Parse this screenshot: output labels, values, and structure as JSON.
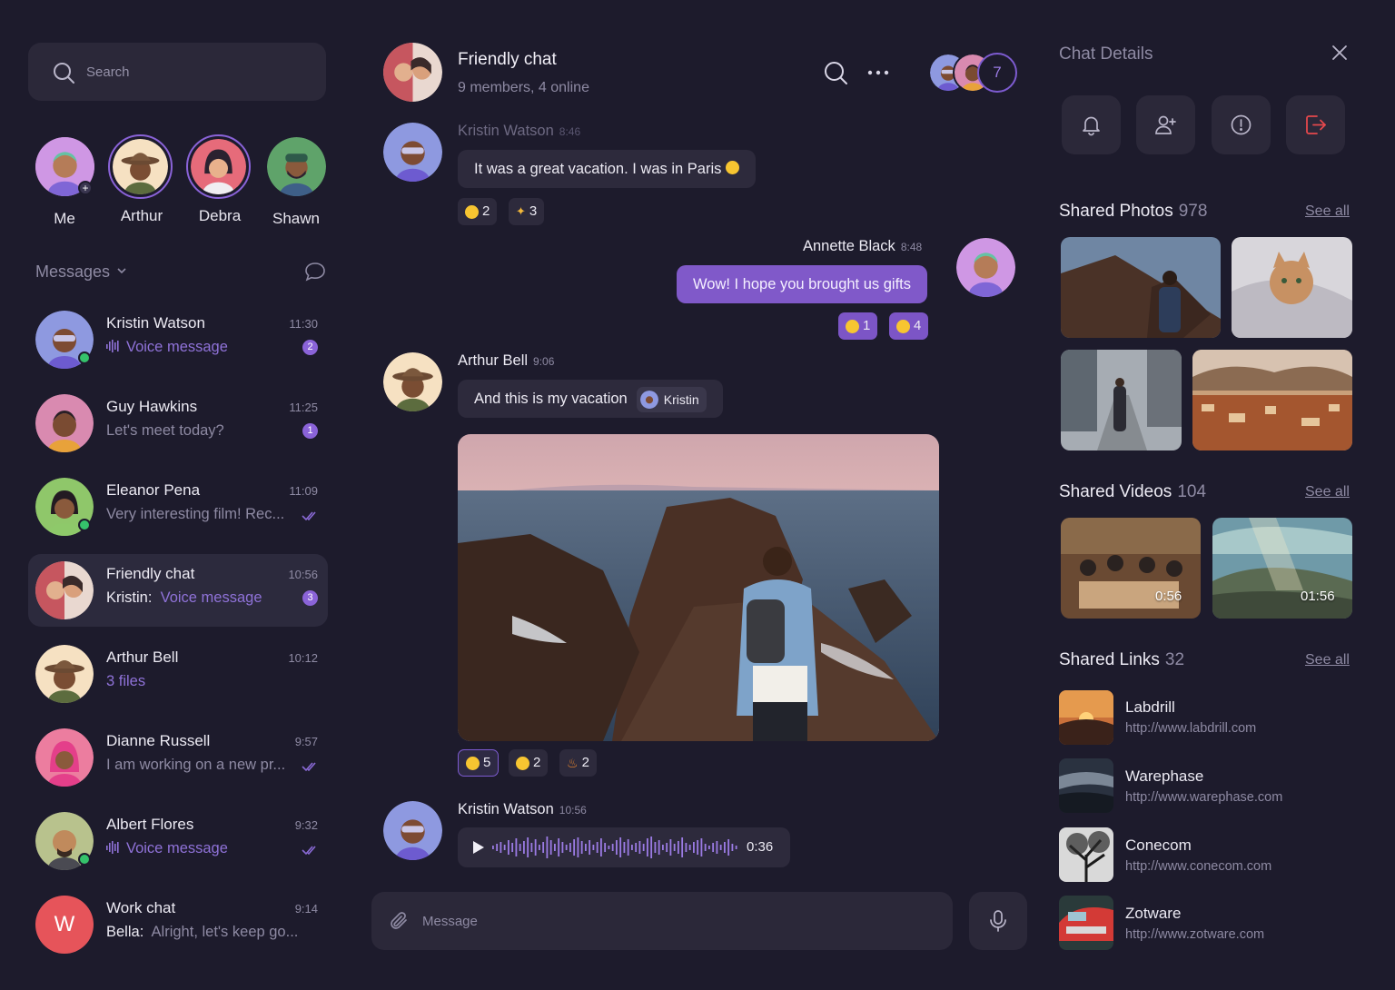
{
  "search": {
    "placeholder": "Search"
  },
  "stories": [
    {
      "name": "Me"
    },
    {
      "name": "Arthur"
    },
    {
      "name": "Debra"
    },
    {
      "name": "Shawn"
    }
  ],
  "messages_header": "Messages",
  "conversations": [
    {
      "name": "Kristin Watson",
      "time": "11:30",
      "preview": "Voice message",
      "badge": "2"
    },
    {
      "name": "Guy Hawkins",
      "time": "11:25",
      "preview": "Let's meet today?",
      "badge": "1"
    },
    {
      "name": "Eleanor Pena",
      "time": "11:09",
      "preview": "Very interesting film! Rec..."
    },
    {
      "name": "Friendly chat",
      "time": "10:56",
      "preview_prefix": "Kristin:",
      "preview": "Voice message",
      "badge": "3"
    },
    {
      "name": "Arthur Bell",
      "time": "10:12",
      "preview": "3 files"
    },
    {
      "name": "Dianne Russell",
      "time": "9:57",
      "preview": "I am working on a new pr..."
    },
    {
      "name": "Albert Flores",
      "time": "9:32",
      "preview": "Voice message"
    },
    {
      "name": "Work chat",
      "time": "9:14",
      "preview_prefix": "Bella:",
      "preview": "Alright, let's keep go...",
      "initial": "W"
    }
  ],
  "chat": {
    "title": "Friendly chat",
    "subtitle": "9 members, 4 online",
    "member_extra": "7",
    "messages": [
      {
        "sender": "Kristin Watson",
        "time": "8:46",
        "text": "It was a great vacation. I was in Paris",
        "reactions": [
          {
            "count": "2"
          },
          {
            "count": "3"
          }
        ]
      },
      {
        "sender": "Annette Black",
        "time": "8:48",
        "text": "Wow! I hope you brought us gifts",
        "reactions": [
          {
            "count": "1"
          },
          {
            "count": "4"
          }
        ]
      },
      {
        "sender": "Arthur Bell",
        "time": "9:06",
        "text": "And this is my vacation",
        "mention": "Kristin",
        "reactions": [
          {
            "count": "5"
          },
          {
            "count": "2"
          },
          {
            "count": "2"
          }
        ]
      },
      {
        "sender": "Kristin Watson",
        "time": "10:56",
        "voice_duration": "0:36"
      }
    ],
    "composer_placeholder": "Message"
  },
  "details": {
    "title": "Chat Details",
    "photos": {
      "title": "Shared Photos",
      "count": "978",
      "see_all": "See all"
    },
    "videos": {
      "title": "Shared Videos",
      "count": "104",
      "see_all": "See all",
      "durations": [
        "0:56",
        "01:56"
      ]
    },
    "links": {
      "title": "Shared Links",
      "count": "32",
      "see_all": "See all",
      "items": [
        {
          "name": "Labdrill",
          "url": "http://www.labdrill.com"
        },
        {
          "name": "Warephase",
          "url": "http://www.warephase.com"
        },
        {
          "name": "Conecom",
          "url": "http://www.conecom.com"
        },
        {
          "name": "Zotware",
          "url": "http://www.zotware.com"
        }
      ]
    }
  },
  "colors": {
    "background": "#1d1b2c",
    "panel": "#2b2839",
    "accent": "#8059c9",
    "online": "#35c26b",
    "danger": "#e5484d"
  }
}
